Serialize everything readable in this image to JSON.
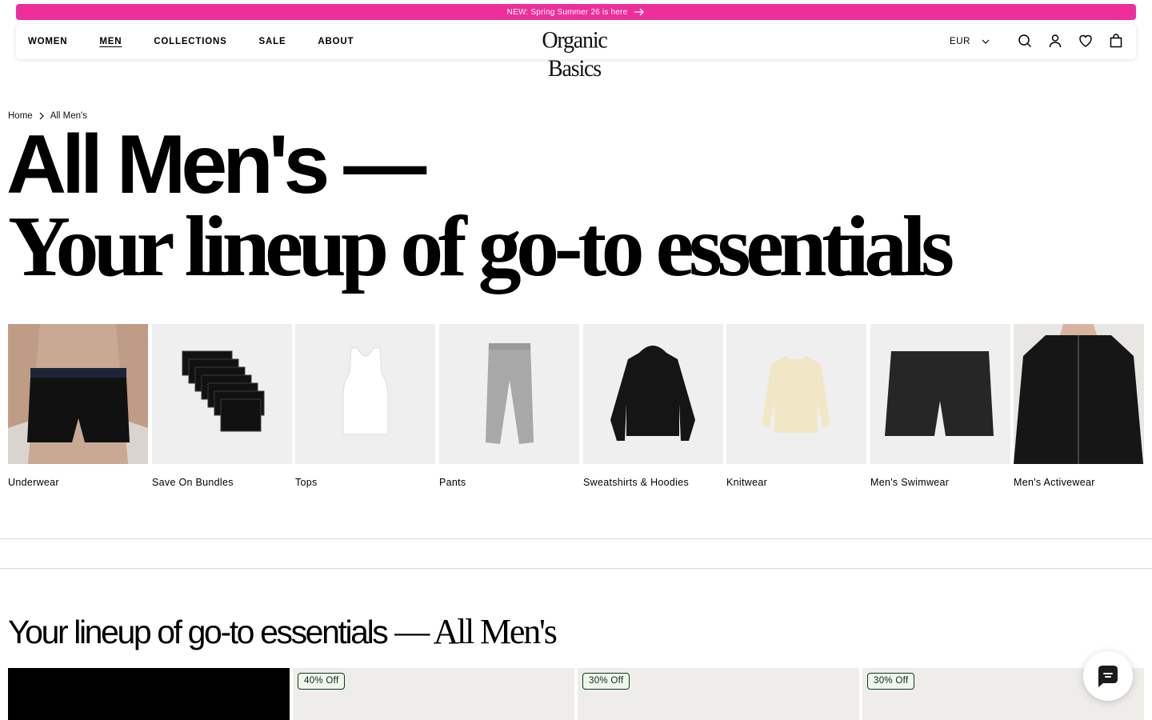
{
  "announcement": {
    "text": "NEW: Spring Summer 26 is here"
  },
  "header": {
    "nav": [
      {
        "label": "WOMEN",
        "active": false
      },
      {
        "label": "MEN",
        "active": true
      },
      {
        "label": "COLLECTIONS",
        "active": false
      },
      {
        "label": "SALE",
        "active": false
      },
      {
        "label": "ABOUT",
        "active": false
      }
    ],
    "logo": "Organic Basics",
    "currency": "EUR",
    "icons": [
      "search-icon",
      "account-icon",
      "wishlist-heart-icon",
      "cart-bag-icon"
    ]
  },
  "breadcrumb": {
    "home": "Home",
    "current": "All Men's"
  },
  "hero": {
    "title": "All Men's —",
    "subtitle": "Your lineup of go-to essentials"
  },
  "categories": [
    {
      "label": "Underwear"
    },
    {
      "label": "Save On Bundles"
    },
    {
      "label": "Tops"
    },
    {
      "label": "Pants"
    },
    {
      "label": "Sweatshirts & Hoodies"
    },
    {
      "label": "Knitwear"
    },
    {
      "label": "Men's Swimwear"
    },
    {
      "label": "Men's Activewear"
    }
  ],
  "section": {
    "heading_sans": "Your lineup of go-to essentials",
    "heading_serif": "— All Men's"
  },
  "products": [
    {
      "badge": ""
    },
    {
      "badge": "40% Off"
    },
    {
      "badge": "30% Off"
    },
    {
      "badge": "30% Off"
    }
  ],
  "colors": {
    "announcement_bg": "#ee2e9b",
    "tile_bg": "#efefef",
    "badge_border": "#0c3b22",
    "badge_bg": "#eef7ea"
  }
}
